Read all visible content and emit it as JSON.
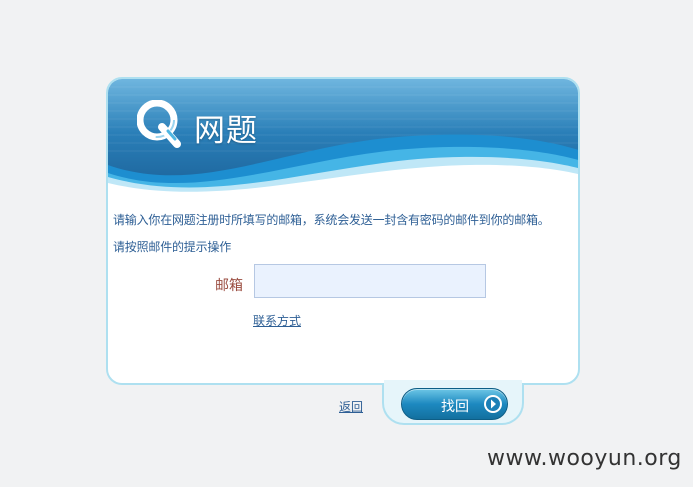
{
  "header": {
    "logo_text": "网题"
  },
  "form": {
    "instruction_line1": "请输入你在网题注册时所填写的邮箱，系统会发送一封含有密码的邮件到你的邮箱。",
    "instruction_line2": "请按照邮件的提示操作",
    "email_label": "邮箱",
    "email_value": "",
    "email_placeholder": "",
    "contact_link": "联系方式"
  },
  "actions": {
    "return_label": "返回",
    "find_button_label": "找回"
  },
  "watermark": "www.wooyun.org",
  "colors": {
    "page_background": "#f1f2f3",
    "header_dark": "#1f6ea8",
    "header_light": "#4eb6e2",
    "frame_border": "#aee0f0",
    "link": "#2e5f95",
    "label": "#9a4c40",
    "input_background": "#eaf2fe"
  },
  "icons": {
    "logo": "q-logo-icon",
    "button_arrow": "arrow-right-circle-icon"
  }
}
